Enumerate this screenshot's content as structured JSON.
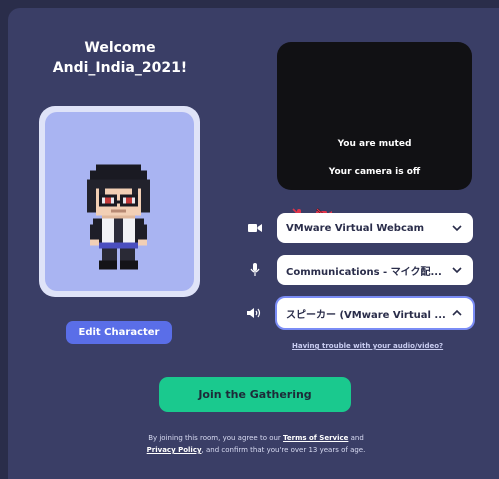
{
  "welcome": {
    "line1": "Welcome",
    "line2": "Andi_India_2021!"
  },
  "avatar": {
    "edit_label": "Edit Character"
  },
  "video": {
    "muted_text": "You are muted",
    "camera_text": "Your camera is off",
    "mic_off_icon": "mic-off-icon",
    "camera_off_icon": "camera-off-icon",
    "status_color": "#e0344b"
  },
  "devices": {
    "camera": {
      "icon": "video-camera-icon",
      "value": "VMware Virtual Webcam"
    },
    "microphone": {
      "icon": "microphone-icon",
      "value": "Communications - マイク配..."
    },
    "speaker": {
      "icon": "speaker-icon",
      "value": "スピーカー (VMware Virtual ..."
    }
  },
  "trouble_link": "Having trouble with your audio/video?",
  "join_label": "Join the Gathering",
  "footer": {
    "part1": "By joining this room, you agree to our",
    "terms_link": "Terms of Service",
    "part2": "and",
    "privacy_link": "Privacy Policy",
    "part3": ", and confirm that you're over 13 years of age."
  },
  "colors": {
    "background": "#3a3e66",
    "accent_button": "#5a6ee8",
    "join_button": "#1ac98e",
    "avatar_card": "#a9b4f2"
  }
}
